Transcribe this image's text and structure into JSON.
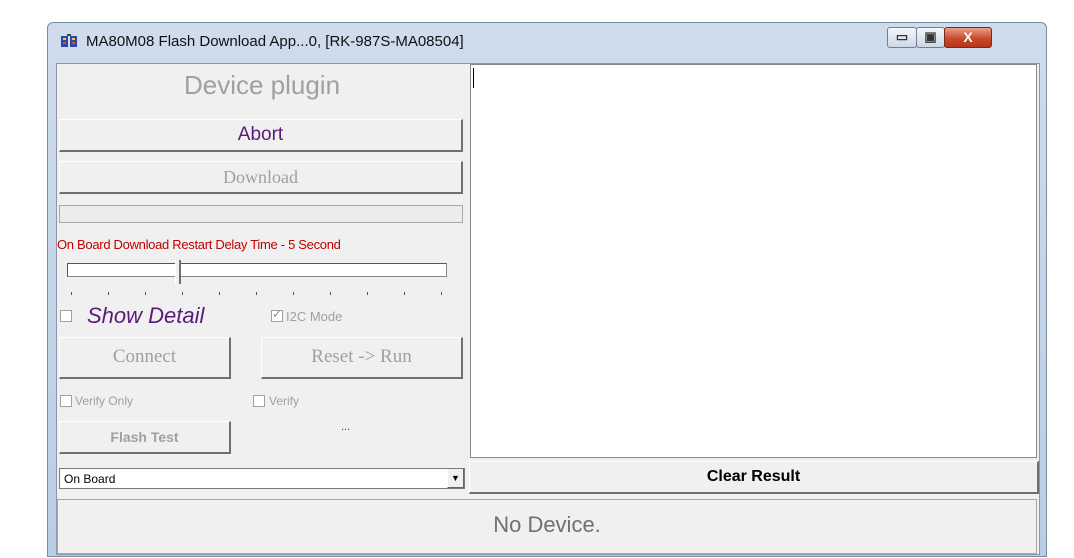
{
  "window": {
    "title": "MA80M08 Flash Download App...0, [RK-987S-MA08504]",
    "controls": {
      "minimize": "▭",
      "maximize": "▣",
      "close": "X"
    }
  },
  "panel": {
    "plugin_title": "Device plugin",
    "abort_label": "Abort",
    "download_label": "Download",
    "delay_label": "On Board Download Restart Delay Time - 5 Second",
    "delay_slider_value_seconds": 5,
    "show_detail": {
      "label": "Show Detail",
      "checked": false
    },
    "i2c_mode": {
      "label": "I2C Mode",
      "checked": true
    },
    "connect_label": "Connect",
    "reset_run_label": "Reset -> Run",
    "verify_only": {
      "label": "Verify Only",
      "checked": false
    },
    "verify": {
      "label": "Verify",
      "checked": false
    },
    "flash_test_label": "Flash Test",
    "dots_text": "...",
    "mode_select": {
      "value": "On Board"
    }
  },
  "result": {
    "clear_label": "Clear Result",
    "text": ""
  },
  "status": {
    "text": "No Device."
  },
  "colors": {
    "accent_purple": "#5a1a7a",
    "warning_red": "#c00000",
    "disabled_gray": "#a0a0a0"
  }
}
